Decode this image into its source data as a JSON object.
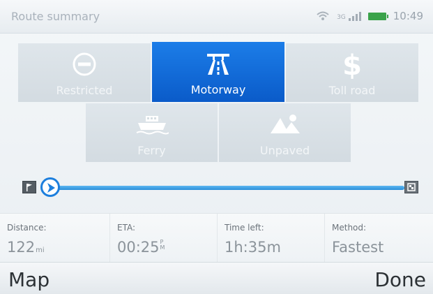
{
  "status_bar": {
    "title": "Route summary",
    "signal_text": "3G",
    "time": "10:49"
  },
  "options": [
    {
      "id": "restricted",
      "label": "Restricted",
      "icon": "no-entry-icon",
      "selected": false
    },
    {
      "id": "motorway",
      "label": "Motorway",
      "icon": "motorway-icon",
      "selected": true
    },
    {
      "id": "toll",
      "label": "Toll road",
      "icon": "dollar-icon",
      "selected": false
    },
    {
      "id": "ferry",
      "label": "Ferry",
      "icon": "ferry-icon",
      "selected": false
    },
    {
      "id": "unpaved",
      "label": "Unpaved",
      "icon": "unpaved-icon",
      "selected": false
    }
  ],
  "route": {
    "progress_fraction": 0.02
  },
  "info": {
    "distance": {
      "caption": "Distance:",
      "value": "122",
      "unit": "mi"
    },
    "eta": {
      "caption": "ETA:",
      "value": "00:25",
      "ampm_top": "P",
      "ampm_bottom": "M"
    },
    "time_left": {
      "caption": "Time left:",
      "value": "1h:35m"
    },
    "method": {
      "caption": "Method:",
      "value": "Fastest"
    }
  },
  "softkeys": {
    "left": "Map",
    "right": "Done"
  },
  "colors": {
    "accent": "#0a5bc9",
    "route_line": "#2b8fd9",
    "battery": "#3aa24a"
  }
}
